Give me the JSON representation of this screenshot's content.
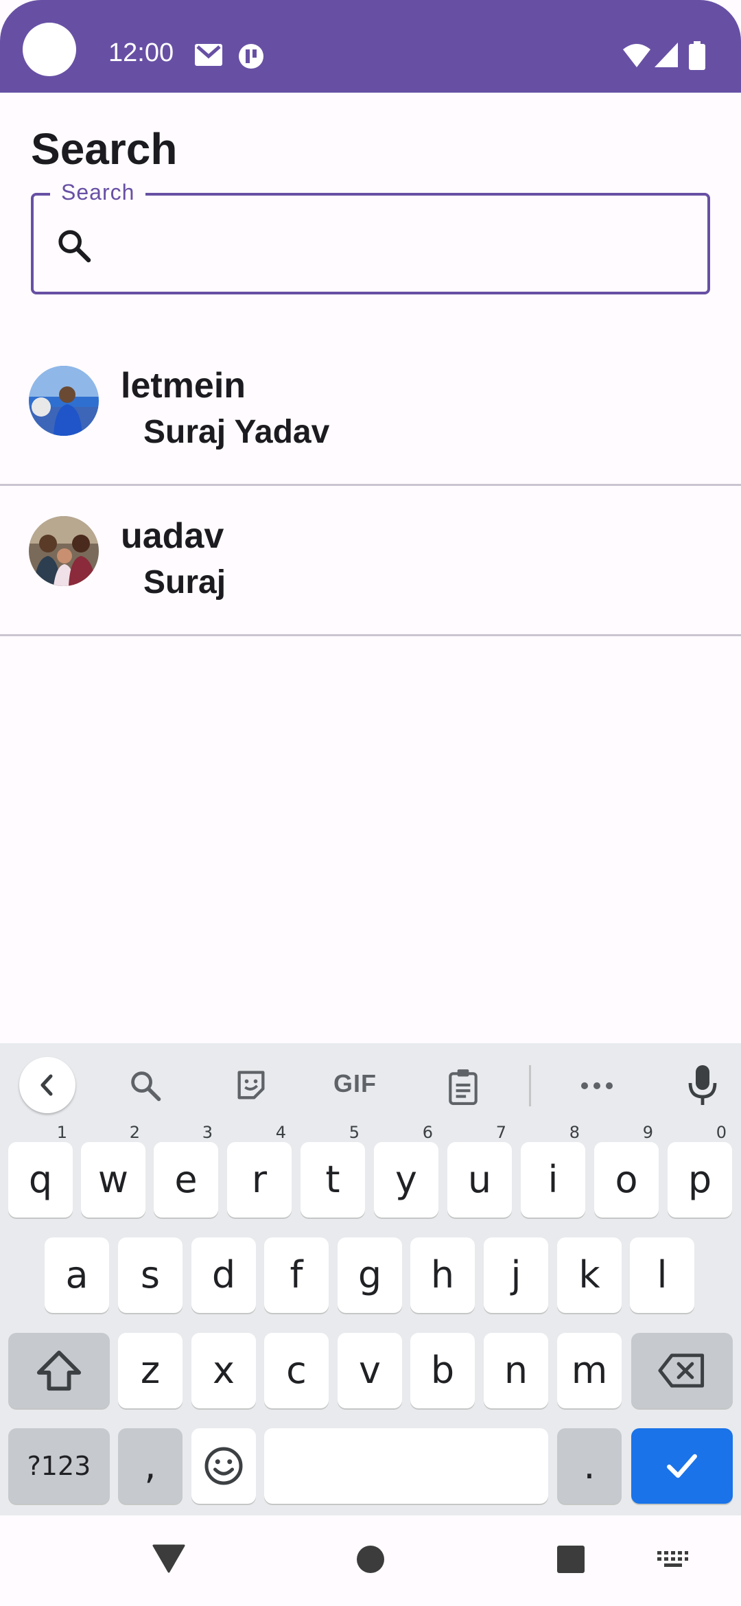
{
  "status_bar": {
    "time": "12:00"
  },
  "page": {
    "title": "Search"
  },
  "search": {
    "label": "Search",
    "value": "",
    "placeholder": ""
  },
  "results": [
    {
      "username": "letmein",
      "name": "Suraj Yadav"
    },
    {
      "username": "uadav",
      "name": "Suraj"
    }
  ],
  "keyboard": {
    "toolbar": {
      "gif_label": "GIF"
    },
    "row1": [
      {
        "k": "q",
        "h": "1"
      },
      {
        "k": "w",
        "h": "2"
      },
      {
        "k": "e",
        "h": "3"
      },
      {
        "k": "r",
        "h": "4"
      },
      {
        "k": "t",
        "h": "5"
      },
      {
        "k": "y",
        "h": "6"
      },
      {
        "k": "u",
        "h": "7"
      },
      {
        "k": "i",
        "h": "8"
      },
      {
        "k": "o",
        "h": "9"
      },
      {
        "k": "p",
        "h": "0"
      }
    ],
    "row2": [
      "a",
      "s",
      "d",
      "f",
      "g",
      "h",
      "j",
      "k",
      "l"
    ],
    "row3": [
      "z",
      "x",
      "c",
      "v",
      "b",
      "n",
      "m"
    ],
    "symbols_label": "?123",
    "comma_label": ",",
    "period_label": "."
  },
  "colors": {
    "accent": "#6750a4",
    "enter": "#1a73e8"
  }
}
